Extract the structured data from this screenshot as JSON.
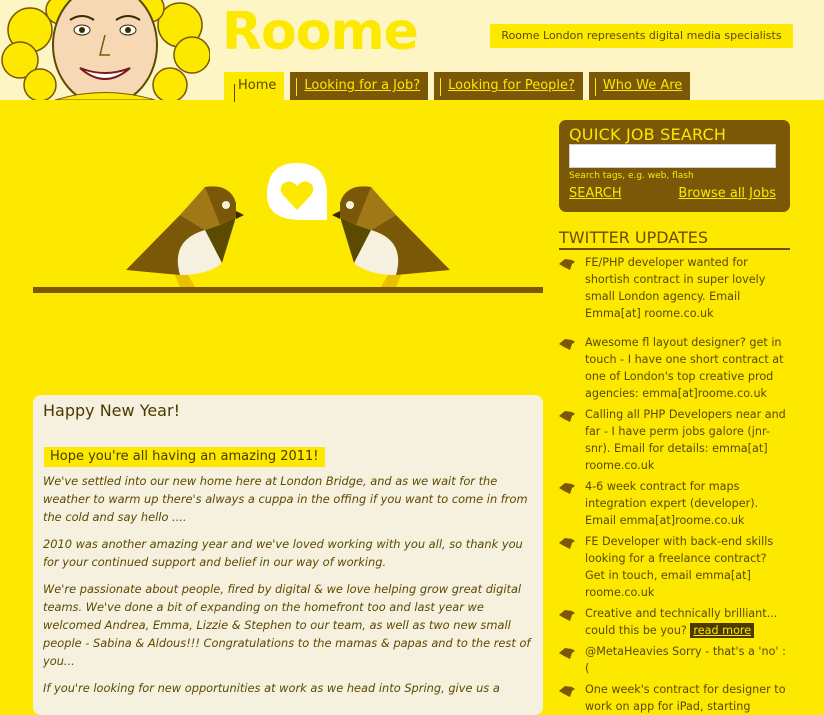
{
  "header": {
    "logo": "Roome",
    "tagline": "Roome London represents digital media specialists"
  },
  "nav": [
    {
      "label": "Home",
      "active": true
    },
    {
      "label": "Looking for a Job?"
    },
    {
      "label": "Looking for People?"
    },
    {
      "label": "Who We Are"
    }
  ],
  "content": {
    "title": "Happy New Year!",
    "highlight": "Hope you're all having an amazing 2011!",
    "paragraphs": [
      "We've settled into our new home here at London Bridge, and as we wait for the weather to warm up there's always a cuppa in the offing if you want to come in from the cold and say hello ....",
      "2010 was another amazing year and we've loved working with you all, so thank you for your continued support and belief in our way of working.",
      "We're passionate about people, fired by digital & we love helping grow great digital teams. We've done a bit of expanding on the homefront too and last year we welcomed Andrea, Emma, Lizzie & Stephen to our team, as well as two new small people - Sabina & Aldous!!!  Congratulations to the mamas & papas and to the rest of you...",
      "If you're looking for new opportunities at work as we head into Spring, give us a"
    ]
  },
  "search": {
    "title": "QUICK JOB SEARCH",
    "input_value": "",
    "hint": "Search tags, e.g. web, flash",
    "button": "SEARCH",
    "browse": "Browse all Jobs"
  },
  "twitter": {
    "title": "TWITTER UPDATES",
    "tweets": [
      "FE/PHP developer wanted for shortish contract in super lovely small London agency. Email Emma[at] roome.co.uk",
      "Awesome fl layout designer? get in touch - I have one short contract at one of London's top creative prod agencies: emma[at]roome.co.uk",
      "Calling all PHP Developers near and far - I have perm jobs galore (jnr-snr). Email for details: emma[at] roome.co.uk",
      "4-6 week contract for maps integration expert (developer). Email emma[at]roome.co.uk",
      "FE Developer with back-end skills looking for a freelance contract? Get in touch, email emma[at] roome.co.uk",
      "Creative and technically brilliant... could this be you?",
      "@MetaHeavies Sorry - that's a 'no' :(",
      "One week's contract for designer to work on app for iPad, starting"
    ],
    "read_more": "read more"
  },
  "colors": {
    "yellow": "#fde800",
    "brown": "#7a5807",
    "cream": "#f6f1df"
  }
}
